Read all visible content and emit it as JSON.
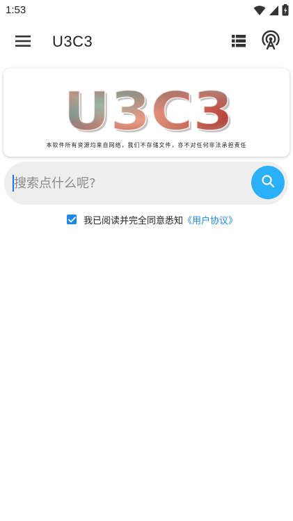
{
  "status_bar": {
    "time": "1:53",
    "icons": [
      "wifi-icon",
      "signal-icon",
      "battery-icon"
    ]
  },
  "app_bar": {
    "title": "U3C3",
    "menu_icon": "hamburger-menu-icon",
    "actions": [
      "list-view-icon",
      "antenna-icon"
    ]
  },
  "banner": {
    "logo_text": "U3C3",
    "tagline": "本软件所有资源均来自网络，我们不存储文件，亦不对任何非法承担责任"
  },
  "search": {
    "placeholder": "搜索点什么呢?",
    "value": "",
    "button_icon": "search-icon"
  },
  "agreement": {
    "checked": true,
    "text": "我已阅读并完全同意悉知",
    "link_text": "《用户协议》"
  },
  "colors": {
    "accent": "#29b0f6",
    "checkbox": "#1e88e5",
    "link": "#1e88e5",
    "search_bg": "#eeeeee"
  }
}
